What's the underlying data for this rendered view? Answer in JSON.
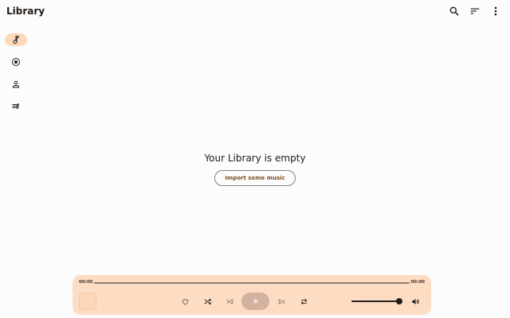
{
  "header": {
    "title": "Library",
    "actions": [
      {
        "name": "search-icon"
      },
      {
        "name": "sort-icon"
      },
      {
        "name": "more-vert-icon"
      }
    ]
  },
  "rail": {
    "items": [
      {
        "name": "songs",
        "icon": "music-note-icon",
        "active": true
      },
      {
        "name": "albums",
        "icon": "album-icon",
        "active": false
      },
      {
        "name": "artists",
        "icon": "person-icon",
        "active": false
      },
      {
        "name": "playlists",
        "icon": "playlist-icon",
        "active": false
      }
    ]
  },
  "empty_state": {
    "title": "Your Library is empty",
    "button_label": "Import some music"
  },
  "player": {
    "current_time": "00:00",
    "total_time": "00:00",
    "progress": 0,
    "volume": 1.0,
    "controls": [
      "heart-icon",
      "shuffle-icon",
      "skip-previous-icon",
      "play-icon",
      "skip-next-icon",
      "repeat-icon"
    ],
    "volume_icon": "volume-icon"
  },
  "colors": {
    "accent": "#fbd9bd",
    "player_bg": "#fcdcc3",
    "play_button": "#d4b2a1",
    "button_text": "#7a4d1f"
  }
}
